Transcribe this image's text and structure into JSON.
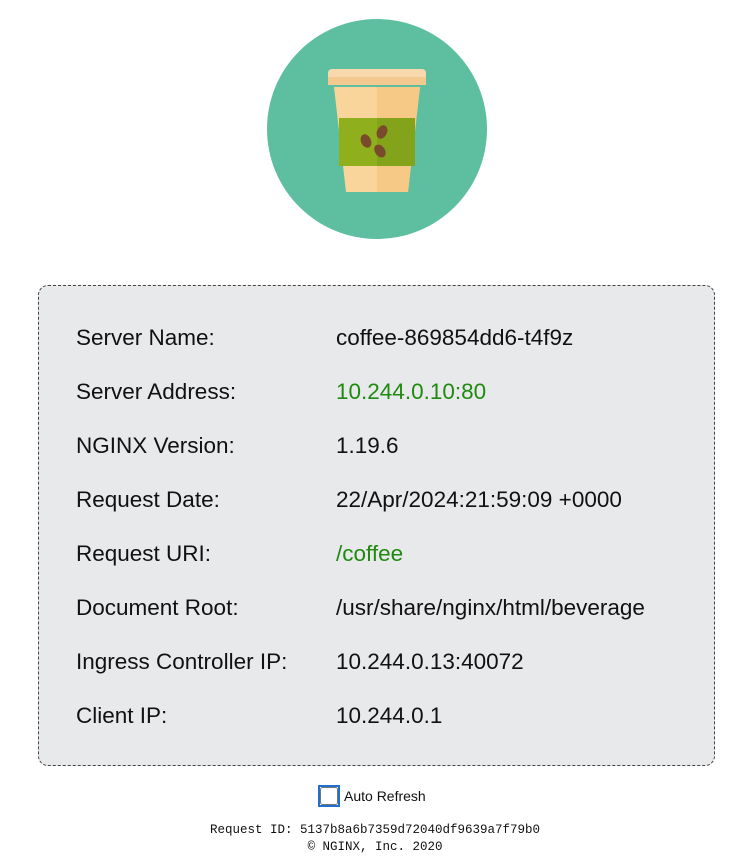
{
  "logo": {
    "icon": "coffee-cup-icon",
    "circle_color": "#5dbf9f"
  },
  "info": {
    "rows": [
      {
        "label": "Server Name:",
        "value": "coffee-869854dd6-t4f9z"
      },
      {
        "label": "Server Address:",
        "value": "10.244.0.10:80"
      },
      {
        "label": "NGINX Version:",
        "value": "1.19.6"
      },
      {
        "label": "Request Date:",
        "value": "22/Apr/2024:21:59:09 +0000"
      },
      {
        "label": "Request URI:",
        "value": "/coffee"
      },
      {
        "label": "Document Root:",
        "value": "/usr/share/nginx/html/beverage"
      },
      {
        "label": "Ingress Controller IP:",
        "value": "10.244.0.13:40072"
      },
      {
        "label": "Client IP:",
        "value": "10.244.0.1"
      }
    ],
    "highlight_color": "#1f8a0f"
  },
  "controls": {
    "auto_refresh_label": "Auto Refresh",
    "auto_refresh_checked": false
  },
  "footer": {
    "request_id": "Request ID: 5137b8a6b7359d72040df9639a7f79b0",
    "copyright": "© NGINX, Inc. 2020"
  }
}
